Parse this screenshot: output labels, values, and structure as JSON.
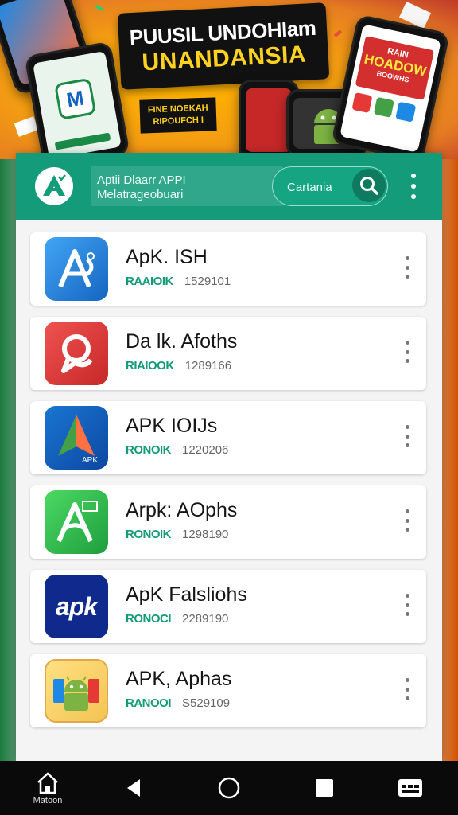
{
  "banner": {
    "headline_line1": "PUUSIL UNDOHIam",
    "headline_line2": "UNANDANSIA",
    "tag_line1": "FINE NOEKAH",
    "tag_line2": "RIPOUFCH I",
    "phone_poster_line1": "RAIN",
    "phone_poster_line2": "HOADOW",
    "phone_poster_line3": "BOOWHS"
  },
  "appbar": {
    "brand_line1": "Aptii Dlaarr APPI",
    "brand_line2": "Melatrageobuari",
    "search_placeholder": "Cartania"
  },
  "apps": [
    {
      "title": "ApK. ISH",
      "badge": "RAAIOIK",
      "downloads": "1529101",
      "icon": "apk-a-blue-icon",
      "color": "#1e88e5"
    },
    {
      "title": "Da lk. Afoths",
      "badge": "RIAIOOK",
      "downloads": "1289166",
      "icon": "red-loop-icon",
      "color": "#e53935"
    },
    {
      "title": "APK IOIJs",
      "badge": "RONOIK",
      "downloads": "1220206",
      "icon": "apk-triangle-icon",
      "color": "#1565c0"
    },
    {
      "title": "Arpk: AOphs",
      "badge": "RONOIK",
      "downloads": "1298190",
      "icon": "apk-a-green-icon",
      "color": "#2eb84c"
    },
    {
      "title": "ApK Falsliohs",
      "badge": "RONOCI",
      "downloads": "2289190",
      "icon": "apk-wordmark-icon",
      "color": "#0f2a8c",
      "wordmark": "apk"
    },
    {
      "title": "APK, Aphas",
      "badge": "RANOOI",
      "downloads": "S529109",
      "icon": "android-robot-icon",
      "color": "#f3c453"
    }
  ],
  "nav": {
    "home_label": "Matoon"
  },
  "colors": {
    "accent": "#149b7a",
    "badge_green": "#149b7a",
    "banner_orange": "#f39c12",
    "headline_yellow": "#ffd21f"
  }
}
